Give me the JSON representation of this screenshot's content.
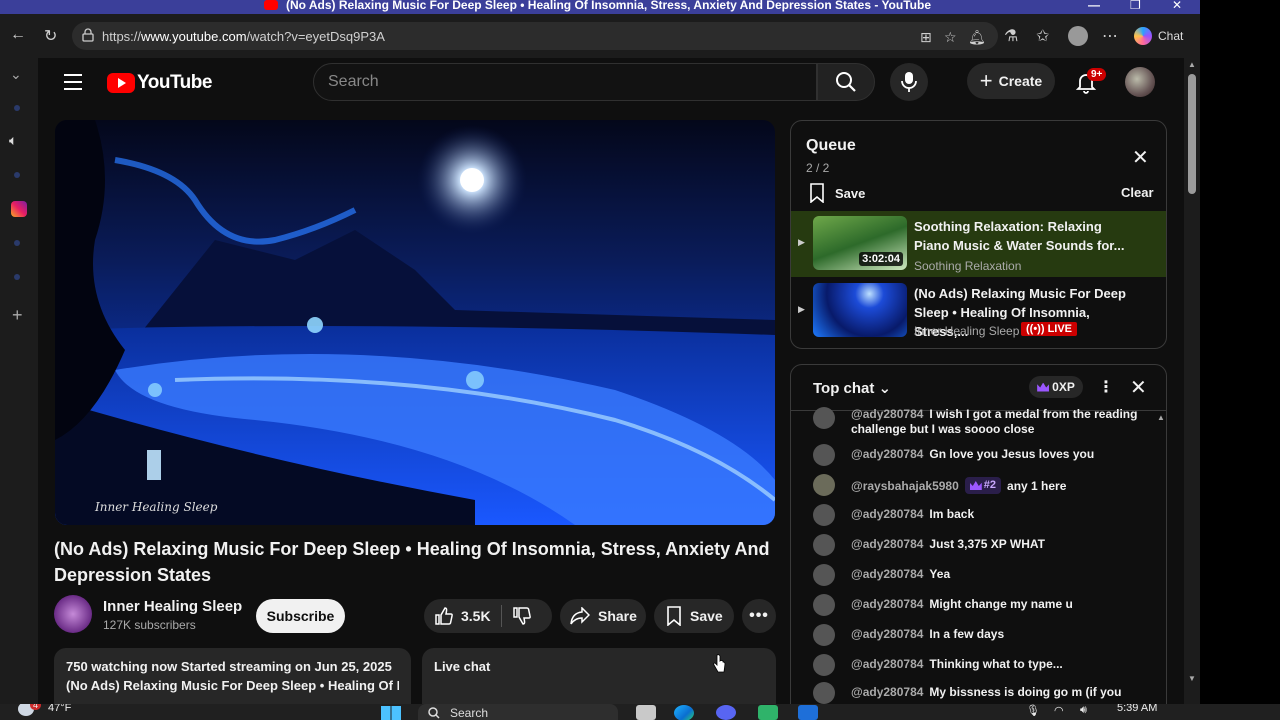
{
  "window": {
    "title": "(No Ads) Relaxing Music For Deep Sleep • Healing Of Insomnia, Stress, Anxiety And Depression States - YouTube"
  },
  "browser": {
    "url_prefix": "https://",
    "url_domain": "www.youtube.com",
    "url_path": "/watch?v=eyetDsq9P3A",
    "chat_label": "Chat"
  },
  "masthead": {
    "logo_text": "YouTube",
    "search_placeholder": "Search",
    "create_label": "Create",
    "notifications_badge": "9+"
  },
  "video": {
    "watermark": "Inner Healing Sleep",
    "title": "(No Ads) Relaxing Music For Deep Sleep • Healing Of Insomnia, Stress, Anxiety And Depression States",
    "channel_name": "Inner Healing Sleep",
    "subscribers": "127K subscribers",
    "subscribe_label": "Subscribe",
    "likes": "3.5K",
    "share_label": "Share",
    "save_label": "Save",
    "description_line1": "750 watching now  Started streaming on Jun 25, 2025",
    "description_line2": "(No Ads) Relaxing Music For Deep Sleep • Healing Of Insomnia",
    "live_chat_label": "Live chat"
  },
  "queue": {
    "title": "Queue",
    "count": "2 / 2",
    "save_label": "Save",
    "clear_label": "Clear",
    "items": [
      {
        "title": "Soothing Relaxation: Relaxing Piano Music & Water Sounds for...",
        "channel": "Soothing Relaxation",
        "duration": "3:02:04"
      },
      {
        "title": "(No Ads) Relaxing Music For Deep Sleep • Healing Of Insomnia, Stress,...",
        "channel": "Inner Healing Sleep",
        "live_label": "LIVE"
      }
    ]
  },
  "chat": {
    "header": "Top chat",
    "xp": "0XP",
    "messages": [
      {
        "author": "@ady280784",
        "text": "I wish I got a medal from the reading challenge but I was soooo close"
      },
      {
        "author": "@ady280784",
        "text": "Gn love you Jesus loves you"
      },
      {
        "author": "@raysbahajak5980",
        "rank": "#2",
        "text": "any 1 here"
      },
      {
        "author": "@ady280784",
        "text": "Im back"
      },
      {
        "author": "@ady280784",
        "text": "Just 3,375 XP WHAT"
      },
      {
        "author": "@ady280784",
        "text": "Yea"
      },
      {
        "author": "@ady280784",
        "text": "Might change my name u"
      },
      {
        "author": "@ady280784",
        "text": "In a few days"
      },
      {
        "author": "@ady280784",
        "text": "Thinking what to type..."
      },
      {
        "author": "@ady280784",
        "text": "My bissness is doing go m (if you"
      }
    ]
  },
  "taskbar": {
    "weather": "47°F",
    "search_label": "Search",
    "time": "5:39 AM",
    "notification_count": "4"
  }
}
